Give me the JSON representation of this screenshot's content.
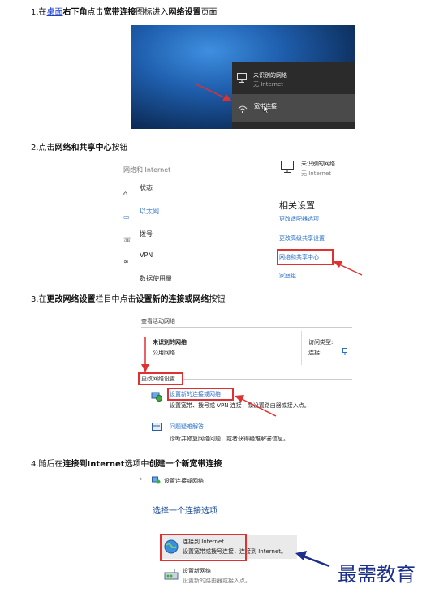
{
  "step1": {
    "num": "1.",
    "pre": "在",
    "link": "桌面",
    "mid": "右下角",
    "post1": "点击",
    "bold1": "宽带连接",
    "post2": "图标进入",
    "bold2": "网络设置",
    "post3": "页面"
  },
  "shot1": {
    "net_title": "未识别的网络",
    "net_sub": "无 Internet",
    "bb_label": "宽带连接"
  },
  "step2": {
    "num": "2.",
    "pre": "点击",
    "bold": "网络和共享中心",
    "post": "按钮"
  },
  "shot2": {
    "header": "网络和 Internet",
    "nav": [
      {
        "icon": "home-icon",
        "label": "状态"
      },
      {
        "icon": "ethernet-icon",
        "label": "以太网"
      },
      {
        "icon": "dialup-icon",
        "label": "拨号"
      },
      {
        "icon": "vpn-icon",
        "label": "VPN"
      },
      {
        "icon": "data-usage-icon",
        "label": "数据使用量"
      }
    ],
    "net_title": "未识别的网络",
    "net_sub": "无 Internet",
    "related_title": "相关设置",
    "links": [
      "更改适配器选项",
      "更改高级共享设置",
      "网络和共享中心",
      "家庭组"
    ]
  },
  "step3": {
    "num": "3.",
    "pre": "在",
    "bold1": "更改网络设置",
    "mid": "栏目中点击",
    "bold2": "设置新的连接或网络",
    "post": "按钮"
  },
  "shot3": {
    "active_header": "查看活动网络",
    "net_name": "未识别的网络",
    "net_type": "公用网络",
    "access_label": "访问类型:",
    "connect_label": "连接:",
    "change_header": "更改网络设置",
    "setup_title": "设置新的连接或网络",
    "setup_desc": "设置宽带、拨号或 VPN 连接；或设置路由器或接入点。",
    "trouble_title": "问题疑难解答",
    "trouble_desc": "诊断并修复网络问题，或者获得疑难解答信息。"
  },
  "step4": {
    "num": "4.",
    "pre": "随后在",
    "bold1": "连接到Internet",
    "mid": "选项中",
    "bold2": "创建一个新宽带连接"
  },
  "shot4": {
    "back": "←",
    "window_title": "设置连接或网络",
    "choose": "选择一个连接选项",
    "opt1_title": "连接到 Internet",
    "opt1_desc": "设置宽带或拨号连接，连接到 Internet。",
    "opt2_title": "设置新网络",
    "opt2_desc": "设置新的路由器或接入点。"
  },
  "watermark": "最需教育",
  "colors": {
    "red": "#e03030",
    "link": "#2a70c8",
    "desktop_dark": "#0d2e5c",
    "popup": "#2b2b2b"
  }
}
